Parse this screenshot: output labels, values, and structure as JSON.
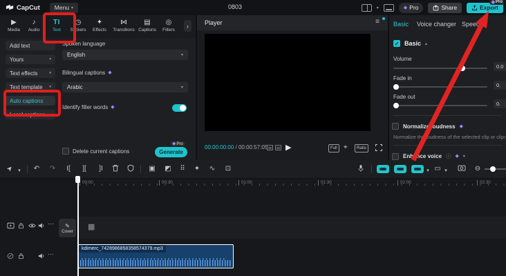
{
  "topbar": {
    "brand": "CapCut",
    "menu_label": "Menu",
    "doc_title": "0803",
    "pro_label": "Pro",
    "share_label": "Share",
    "export_label": "Export",
    "export_pro_badge": "Pro",
    "caret": "▾"
  },
  "ribbon": {
    "tools": [
      {
        "label": "Media",
        "icon": "▶"
      },
      {
        "label": "Audio",
        "icon": "♪"
      },
      {
        "label": "Text",
        "icon": "TI"
      },
      {
        "label": "Stickers",
        "icon": "◷"
      },
      {
        "label": "Effects",
        "icon": "✦"
      },
      {
        "label": "Transitions",
        "icon": "⋈"
      },
      {
        "label": "Captions",
        "icon": "▤"
      },
      {
        "label": "Filters",
        "icon": "◎"
      }
    ],
    "expand_icon": "›"
  },
  "sidebar": {
    "items": [
      {
        "label": "Add text",
        "caret": ""
      },
      {
        "label": "Yours",
        "caret": "▾"
      },
      {
        "label": "Text effects",
        "caret": "▾"
      },
      {
        "label": "Text template",
        "caret": "▾"
      },
      {
        "label": "Auto captions",
        "caret": ""
      },
      {
        "label": "Local captions",
        "caret": ""
      }
    ]
  },
  "captions_form": {
    "spoken_language_label": "Spoken language",
    "spoken_language_value": "English",
    "bilingual_label": "Bilingual captions",
    "bilingual_value": "Arabic",
    "filler_label": "Identify filler words",
    "delete_checkbox_label": "Delete current captions",
    "generate_label": "Generate",
    "generate_pro_badge": "Pro",
    "select_caret": "▾",
    "gem_icon": "◆"
  },
  "player": {
    "title": "Player",
    "menu_icon": "≡",
    "current_time": "00:00:00:00",
    "separator": "/",
    "duration": "00:00:57:05",
    "play_icon": "▶",
    "full_label": "Full",
    "focus_icon": "⌖",
    "ratio_label": "Ratio"
  },
  "inspector": {
    "tabs": [
      {
        "label": "Basic"
      },
      {
        "label": "Voice changer"
      },
      {
        "label": "Speed"
      }
    ],
    "basic_section_label": "Basic",
    "basic_check": "✓",
    "collapse_icon": "▴",
    "volume_label": "Volume",
    "volume_value": "0.0",
    "fade_in_label": "Fade in",
    "fade_in_value": "0.",
    "fade_out_label": "Fade out",
    "fade_out_value": "0.",
    "normalize_label": "Normalize loudness",
    "normalize_desc": "Normalize the loudness of the selected clip or clips t",
    "enhance_label": "Enhance voice",
    "info_icon": "ⓘ",
    "dropdown_icon": "▾",
    "gem_icon": "◆"
  },
  "timeline": {
    "icons": {
      "pointer": "➤",
      "caret": "▾",
      "undo": "↶",
      "redo": "↷",
      "split_left": "I[",
      "split": "][",
      "split_right": "]I",
      "frame": "▣",
      "sticker": "◩",
      "grid": "⠿",
      "wand": "✦",
      "wave": "∿",
      "record": "⊡",
      "clip_view": "▭",
      "zoom_out": "⊖",
      "more": "⋯",
      "film": "▦",
      "pencil": "✎"
    },
    "ruler_labels": [
      "00:00",
      "00:30",
      "01:00",
      "01:30",
      "02:00",
      "02:30"
    ],
    "cover_label": "Cover",
    "audio_clip_name": "kdimerc_7428986858358574379.mp3"
  },
  "colors": {
    "accent_teal": "#1fc3cd",
    "annotation_red": "#e01f1f",
    "pro_purple": "#9c86ff",
    "clip_blue": "#17406b",
    "waveform_blue": "#5e9ee8"
  }
}
